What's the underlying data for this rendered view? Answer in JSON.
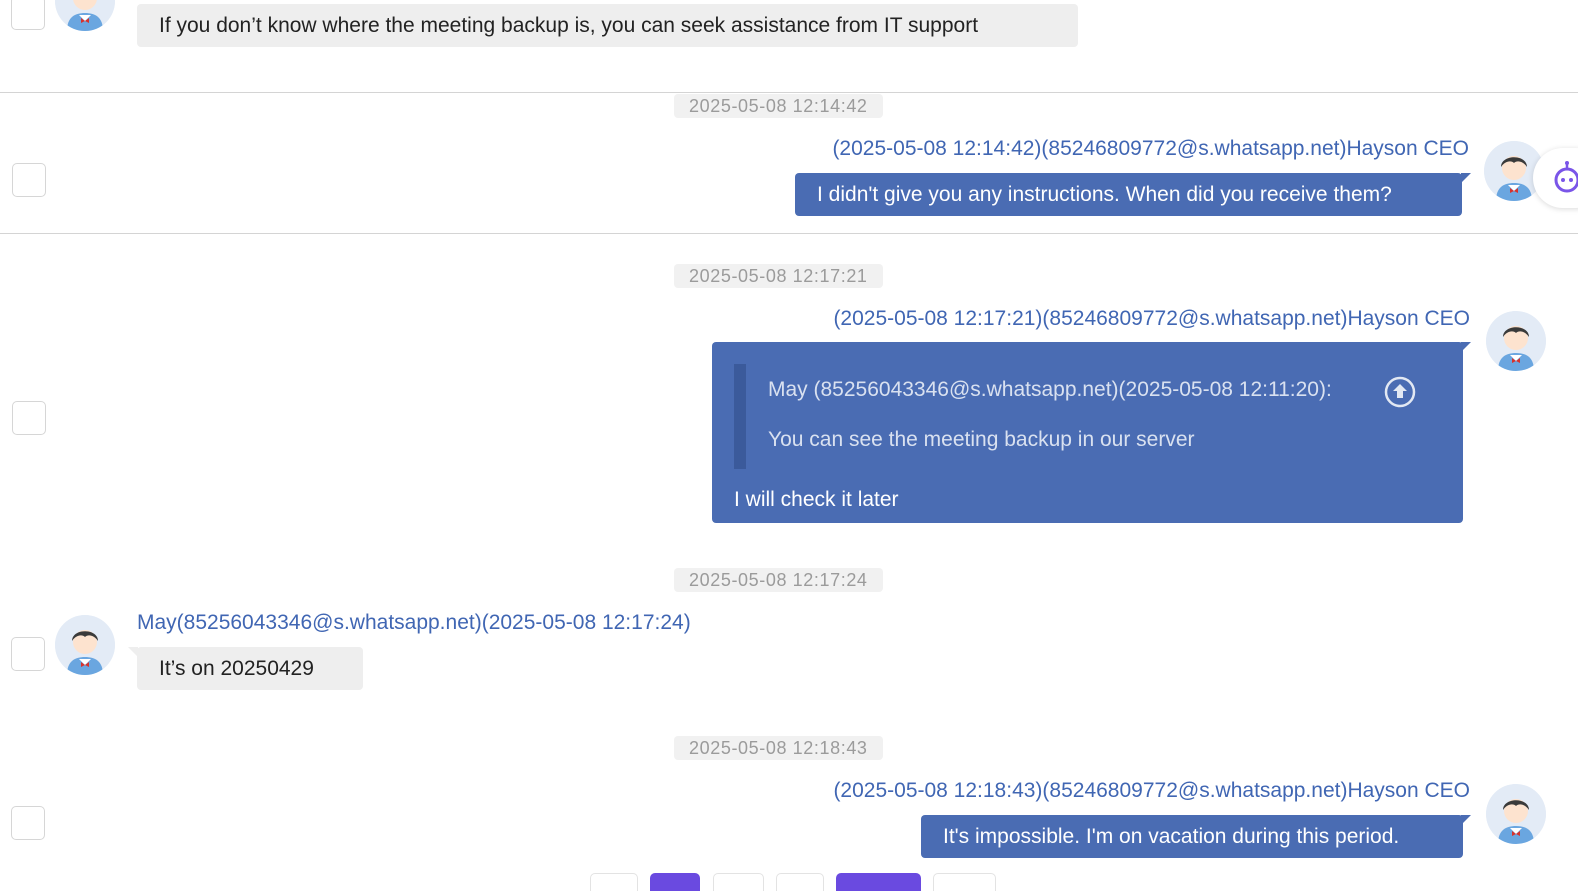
{
  "messages": {
    "m1": {
      "text": "If you don’t know where the meeting backup is, you can seek assistance from IT support"
    },
    "m2": {
      "timestamp": "2025-05-08 12:14:42",
      "sender": "(2025-05-08 12:14:42)(85246809772@s.whatsapp.net)Hayson CEO",
      "text": "I didn't give you any instructions. When did you receive them?"
    },
    "m3": {
      "timestamp": "2025-05-08 12:17:21",
      "sender": "(2025-05-08 12:17:21)(85246809772@s.whatsapp.net)Hayson CEO",
      "quote_header": "May (85256043346@s.whatsapp.net)(2025-05-08 12:11:20):",
      "quote_text": "You can see the meeting backup in our server",
      "text": "I will check it later"
    },
    "m4": {
      "timestamp": "2025-05-08 12:17:24",
      "sender": "May(85256043346@s.whatsapp.net)(2025-05-08 12:17:24)",
      "text": "It’s on 20250429"
    },
    "m5": {
      "timestamp": "2025-05-08 12:18:43",
      "sender": "(2025-05-08 12:18:43)(85246809772@s.whatsapp.net)Hayson CEO",
      "text": "It's impossible. I'm on vacation during this period."
    }
  },
  "icons": {
    "avatar": "person-avatar-icon",
    "quote_jump": "arrow-up-circle-icon",
    "assistant": "robot-assistant-icon"
  },
  "colors": {
    "outgoing_bubble": "#4a6cb3",
    "incoming_bubble": "#eeeeee",
    "sender_text": "#4066b3",
    "pager_active": "#6a4ae0"
  }
}
